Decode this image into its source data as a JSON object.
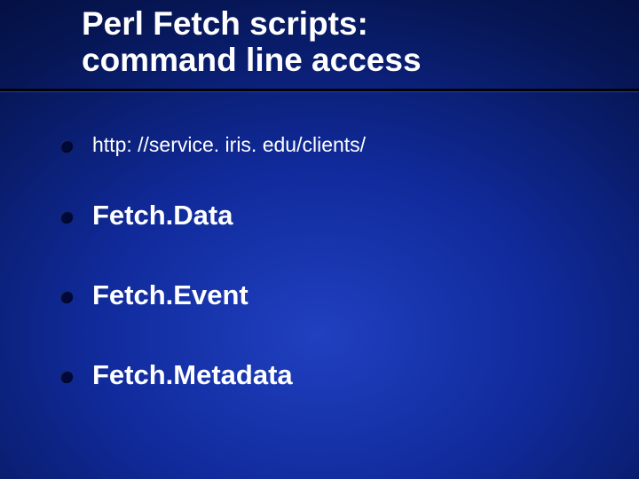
{
  "title": {
    "line1": "Perl Fetch scripts:",
    "line2": "command line access"
  },
  "bullets": {
    "url": "http: //service. iris. edu/clients/",
    "item1": "Fetch.Data",
    "item2": "Fetch.Event",
    "item3": "Fetch.Metadata"
  }
}
